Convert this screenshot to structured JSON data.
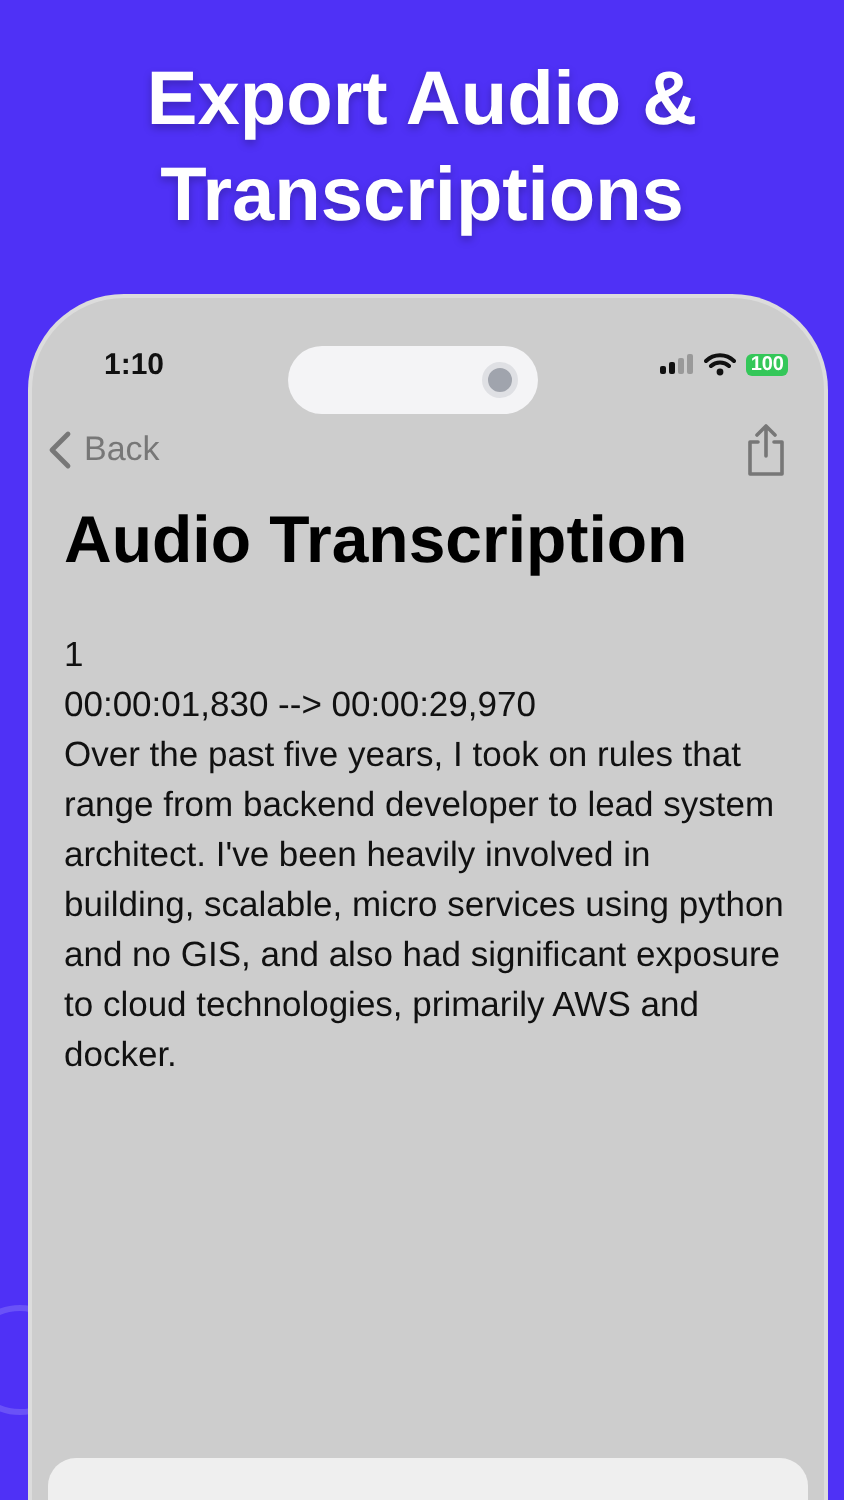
{
  "headline": "Export Audio & Transcriptions",
  "status_bar": {
    "time": "1:10",
    "battery": "100"
  },
  "nav": {
    "back": "Back"
  },
  "title": "Audio Transcription",
  "transcript": [
    "1",
    "00:00:01,830 --> 00:00:29,970",
    "Over the past five years, I took on rules that range from backend developer to lead system architect. I've been heavily involved in building, scalable, micro services using python and no GIS, and also had significant exposure to cloud technologies, primarily AWS and docker."
  ]
}
